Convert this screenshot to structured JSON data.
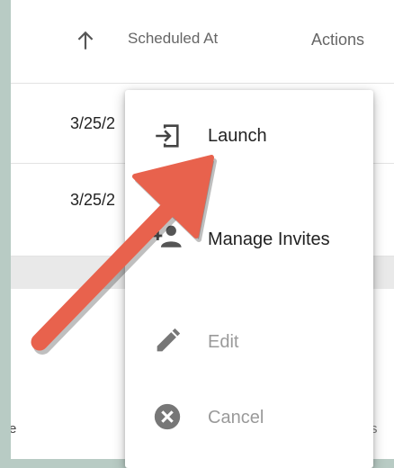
{
  "table": {
    "header": {
      "sort_icon": "arrow-upward-icon",
      "scheduled_at": "Scheduled At",
      "actions": "Actions"
    },
    "rows": [
      {
        "scheduled_at": "3/25/2"
      },
      {
        "scheduled_at": "3/25/2"
      }
    ],
    "partial_text_left": "e",
    "partial_text_right": "s"
  },
  "menu": {
    "items": [
      {
        "label": "Launch",
        "icon": "login-icon",
        "disabled": false
      },
      {
        "label": "Manage Invites",
        "icon": "person-add-icon",
        "disabled": false
      },
      {
        "label": "Edit",
        "icon": "pencil-icon",
        "disabled": true
      },
      {
        "label": "Cancel",
        "icon": "cancel-circle-icon",
        "disabled": true
      }
    ]
  },
  "annotation": {
    "arrow_color": "#e8624d",
    "arrow_icon": "annotation-arrow"
  }
}
